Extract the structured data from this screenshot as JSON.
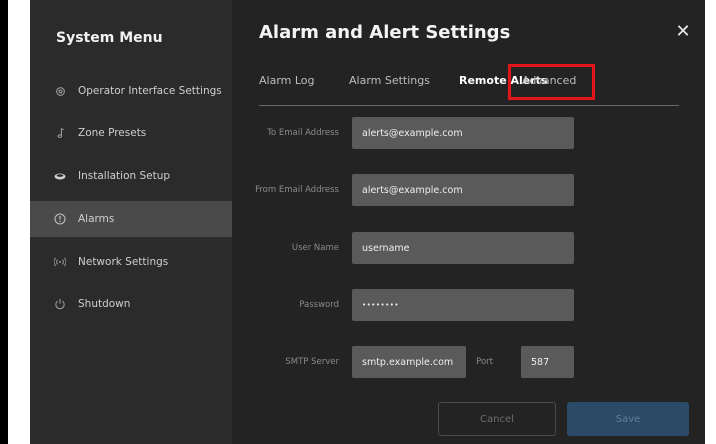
{
  "sidebar": {
    "title": "System Menu",
    "items": [
      {
        "label": "Operator Interface Settings",
        "icon": "gear-icon"
      },
      {
        "label": "Zone Presets",
        "icon": "music-note-icon"
      },
      {
        "label": "Installation Setup",
        "icon": "speaker-icon"
      },
      {
        "label": "Alarms",
        "icon": "alert-icon",
        "active": true
      },
      {
        "label": "Network Settings",
        "icon": "wifi-signal-icon"
      },
      {
        "label": "Shutdown",
        "icon": "power-icon"
      }
    ]
  },
  "header": {
    "title": "Alarm and Alert Settings",
    "close": "✕"
  },
  "tabs": [
    {
      "label": "Alarm Log"
    },
    {
      "label": "Alarm Settings"
    },
    {
      "label": "Remote Alerts",
      "active": true
    },
    {
      "label": "Advanced"
    }
  ],
  "form": {
    "to_email": {
      "label": "To Email Address",
      "value": "alerts@example.com"
    },
    "from_email": {
      "label": "From Email Address",
      "value": "alerts@example.com"
    },
    "username": {
      "label": "User Name",
      "value": "username"
    },
    "password": {
      "label": "Password",
      "value": "••••••••"
    },
    "smtp": {
      "label": "SMTP Server",
      "value": "smtp.example.com"
    },
    "port": {
      "label": "Port",
      "value": "587"
    }
  },
  "buttons": {
    "cancel": "Cancel",
    "save": "Save"
  },
  "colors": {
    "highlight": "#e0151a",
    "save_button": "#2b4a67"
  }
}
